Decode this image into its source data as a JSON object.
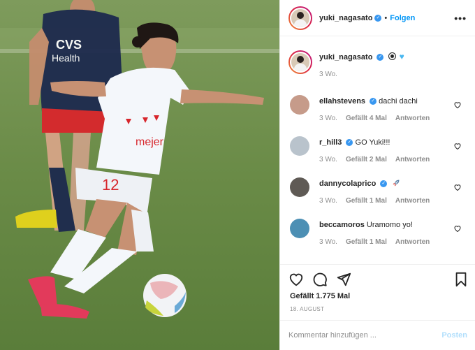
{
  "header": {
    "username": "yuki_nagasato",
    "separator": "•",
    "follow_label": "Folgen",
    "more_label": "•••"
  },
  "caption": {
    "username": "yuki_nagasato",
    "emoji": [
      "soccer-ball",
      "blue-heart"
    ],
    "time": "3 Wo."
  },
  "comments": [
    {
      "username": "ellahstevens",
      "verified": true,
      "text": "dachi dachi",
      "time": "3 Wo.",
      "likes": "Gefällt 4 Mal",
      "reply": "Antworten",
      "avatar": "#c69b8a"
    },
    {
      "username": "r_hill3",
      "verified": true,
      "text": "GO Yuki!!!",
      "time": "3 Wo.",
      "likes": "Gefällt 2 Mal",
      "reply": "Antworten",
      "avatar": "#b9c3cc"
    },
    {
      "username": "dannycolaprico",
      "verified": true,
      "text": "",
      "emoji": "rocket",
      "time": "3 Wo.",
      "likes": "Gefällt 1 Mal",
      "reply": "Antworten",
      "avatar": "#5f5a55"
    },
    {
      "username": "beccamoros",
      "verified": false,
      "text": "Uramomo yo!",
      "time": "3 Wo.",
      "likes": "Gefällt 1 Mal",
      "reply": "Antworten",
      "avatar": "#4c8fb4"
    }
  ],
  "actions": {
    "likes": "Gefällt 1.775 Mal",
    "date": "18. AUGUST"
  },
  "add_comment": {
    "placeholder": "Kommentar hinzufügen ...",
    "post_label": "Posten"
  },
  "colors": {
    "accent": "#0095f6",
    "verified": "#3897f0",
    "muted": "#8e8e8e",
    "post_disabled": "#b2dffc"
  }
}
